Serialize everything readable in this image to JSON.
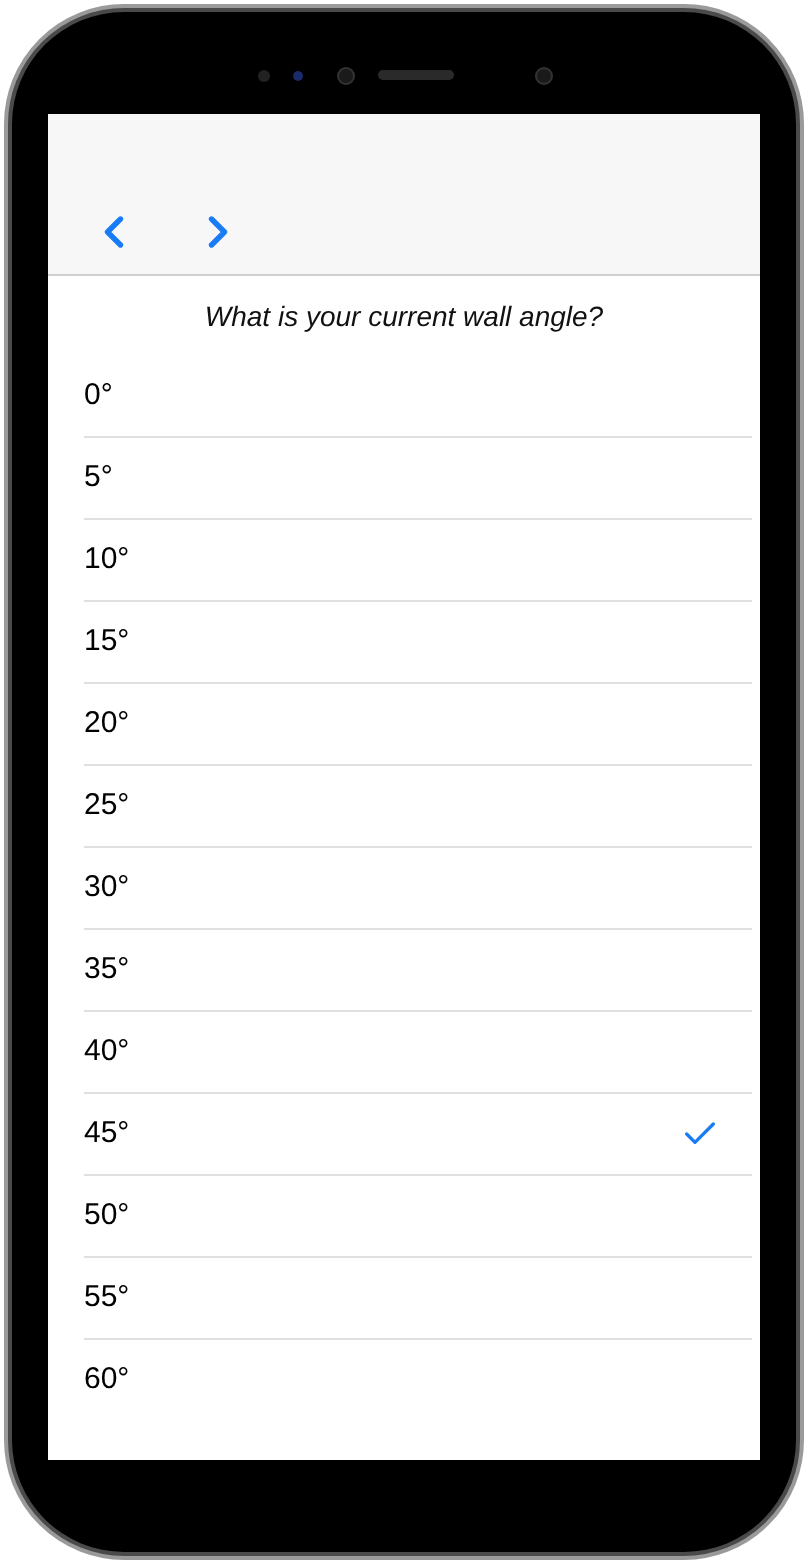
{
  "question": "What is your current wall angle?",
  "options": [
    {
      "label": "0°",
      "selected": false
    },
    {
      "label": "5°",
      "selected": false
    },
    {
      "label": "10°",
      "selected": false
    },
    {
      "label": "15°",
      "selected": false
    },
    {
      "label": "20°",
      "selected": false
    },
    {
      "label": "25°",
      "selected": false
    },
    {
      "label": "30°",
      "selected": false
    },
    {
      "label": "35°",
      "selected": false
    },
    {
      "label": "40°",
      "selected": false
    },
    {
      "label": "45°",
      "selected": true
    },
    {
      "label": "50°",
      "selected": false
    },
    {
      "label": "55°",
      "selected": false
    },
    {
      "label": "60°",
      "selected": false
    }
  ]
}
